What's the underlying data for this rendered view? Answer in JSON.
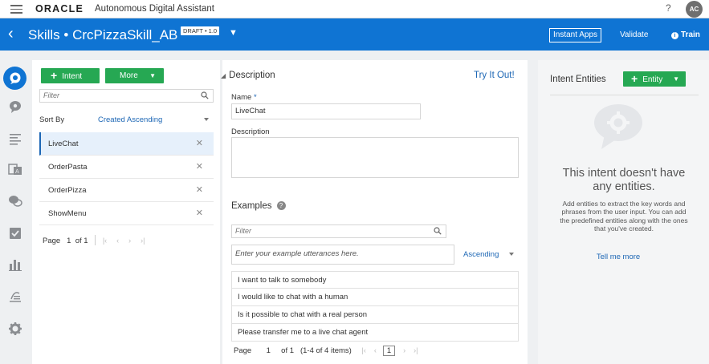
{
  "topbar": {
    "logo": "ORACLE",
    "app_name": "Autonomous Digital Assistant",
    "help": "?",
    "avatar_initials": "AC"
  },
  "header": {
    "title": "Skills • CrcPizzaSkill_AB",
    "badge": "DRAFT • 1.0",
    "instant_apps": "Instant Apps",
    "validate": "Validate",
    "train": "Train",
    "accent_color": "#0f74d3"
  },
  "rail": {
    "icons": [
      "intents-icon",
      "entities-icon",
      "flows-icon",
      "resource-bundles-icon",
      "q-and-a-icon",
      "quality-icon",
      "insights-icon",
      "digital-assistant-routing-icon",
      "settings-icon"
    ]
  },
  "intents": {
    "add_button": "Intent",
    "more_button": "More",
    "filter_placeholder": "Filter",
    "sort_label": "Sort By",
    "sort_value": "Created Ascending",
    "items": [
      {
        "label": "LiveChat",
        "selected": true
      },
      {
        "label": "OrderPasta",
        "selected": false
      },
      {
        "label": "OrderPizza",
        "selected": false
      },
      {
        "label": "ShowMenu",
        "selected": false
      }
    ],
    "pager": {
      "label": "Page",
      "current": "1",
      "of": "of 1"
    }
  },
  "detail": {
    "section_title": "Description",
    "try_it": "Try It Out!",
    "name_label": "Name",
    "required_mark": "*",
    "name_value": "LiveChat",
    "description_label": "Description",
    "description_value": "",
    "examples_title": "Examples",
    "filter_placeholder": "Filter",
    "utterance_placeholder": "Enter your example utterances here.",
    "sort_value": "Ascending",
    "examples": [
      "I want to talk to somebody",
      "I would like to chat with a human",
      "Is it possible to chat with a real person",
      "Please transfer me to a live chat agent"
    ],
    "pager": {
      "label": "Page",
      "current": "1",
      "of": "of 1",
      "range": "(1-4 of 4 items)",
      "page_box": "1"
    }
  },
  "entities": {
    "title": "Intent Entities",
    "add_button": "Entity",
    "empty_title": "This intent doesn't have any entities.",
    "empty_desc": "Add entities to extract the key words and phrases from the user input. You can add the predefined entities along with the ones that you've created.",
    "tell_more": "Tell me more"
  }
}
